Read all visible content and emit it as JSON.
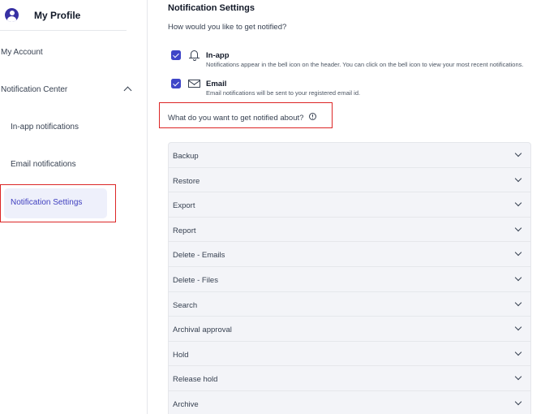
{
  "sidebar": {
    "profile_title": "My Profile",
    "items": {
      "my_account": "My Account",
      "notification_center": "Notification Center",
      "in_app_notifications": "In-app notifications",
      "email_notifications": "Email notifications",
      "notification_settings": "Notification Settings"
    }
  },
  "main": {
    "title": "Notification Settings",
    "question": "How would you like to get notified?",
    "options": {
      "in_app": {
        "title": "In-app",
        "description": "Notifications appear in the bell icon on the header. You can click on the bell icon to view your most recent notifications.",
        "icon": "bell-icon"
      },
      "email": {
        "title": "Email",
        "description": "Email notifications will be sent to your registered email id.",
        "icon": "envelope-icon"
      }
    },
    "about_label": "What do you want to get notified about?",
    "categories": [
      "Backup",
      "Restore",
      "Export",
      "Report",
      "Delete - Emails",
      "Delete - Files",
      "Search",
      "Archival approval",
      "Hold",
      "Release hold",
      "Archive"
    ]
  },
  "colors": {
    "accent": "#3f46c8",
    "highlight": "#dc2626",
    "active_bg": "#eef0fb",
    "accordion_bg": "#f3f4f8"
  }
}
